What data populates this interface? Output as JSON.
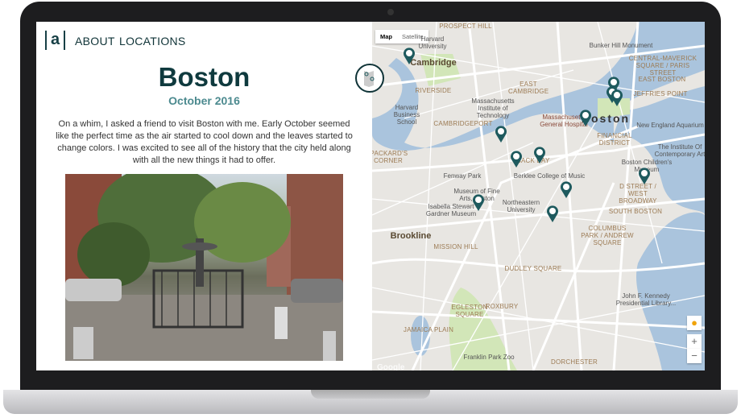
{
  "nav": {
    "about": "ABOUT",
    "locations": "LOCATIONS",
    "logo": "a"
  },
  "post": {
    "title": "Boston",
    "date": "October 2016",
    "body": "On a whim, I asked a friend to visit Boston with me. Early October seemed like the perfect time as the air started to cool down and the leaves started to change colors. I was excited to see all of the history that the city held along with all the new things it had to offer."
  },
  "map": {
    "map_label": "Map",
    "satellite_label": "Satellite",
    "zoom_in": "+",
    "zoom_out": "−",
    "watermark": "Google",
    "labels": [
      "PROSPECT HILL",
      "Harvard University",
      "Cambridge",
      "Bunker Hill Monument",
      "CENTRAL-MAVERICK SQUARE / PARIS STREET",
      "EAST BOSTON",
      "JEFFRIES POINT",
      "RIVERSIDE",
      "EAST CAMBRIDGE",
      "Massachusetts Institute of Technology",
      "Harvard Business School",
      "CAMBRIDGEPORT",
      "Massachusetts General Hospital",
      "Boston",
      "New England Aquarium",
      "FINANCIAL DISTRICT",
      "PACKARD'S CORNER",
      "The Institute Of Contemporary Art",
      "Boston Children's Museum",
      "BACK BAY",
      "Fenway Park",
      "Berklee College of Music",
      "D STREET / WEST BROADWAY",
      "Museum of Fine Arts, Boston",
      "Isabella Stewart Gardner Museum",
      "Northeastern University",
      "SOUTH BOSTON",
      "Brookline",
      "MISSION HILL",
      "COLUMBUS PARK / ANDREW SQUARE",
      "DUDLEY SQUARE",
      "John F. Kennedy Presidential Library...",
      "EGLESTON SQUARE",
      "ROXBURY",
      "JAMAICA PLAIN",
      "Franklin Park Zoo",
      "DORCHESTER"
    ],
    "marker_color": "#1e5a5e",
    "water_color": "#aac4dd",
    "park_color": "#d2e6b8"
  }
}
